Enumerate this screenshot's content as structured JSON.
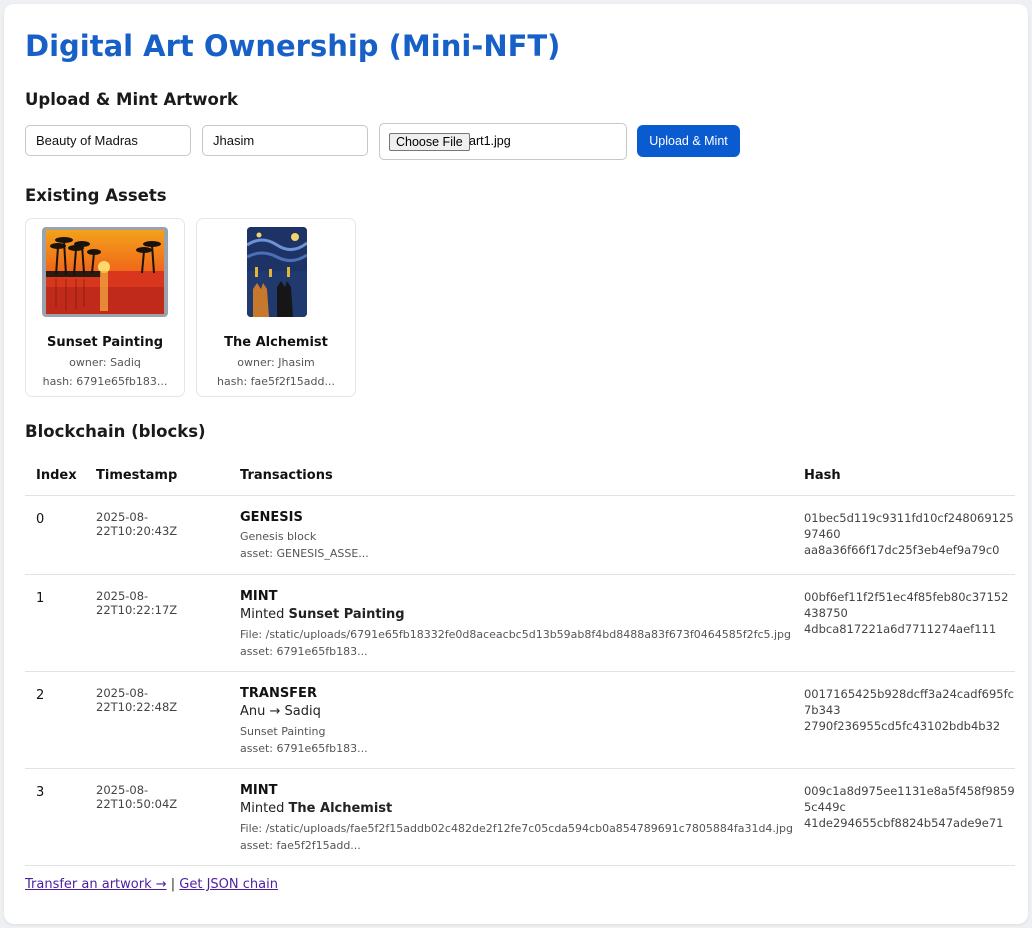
{
  "page": {
    "title": "Digital Art Ownership (Mini-NFT)"
  },
  "upload": {
    "heading": "Upload & Mint Artwork",
    "title_value": "Beauty of Madras",
    "owner_value": "Jhasim",
    "file_button": "Choose File",
    "file_name": "art1.jpg",
    "submit_label": "Upload & Mint"
  },
  "assets": {
    "heading": "Existing Assets",
    "items": [
      {
        "title": "Sunset Painting",
        "owner": "owner: Sadiq",
        "hash": "hash: 6791e65fb183..."
      },
      {
        "title": "The Alchemist",
        "owner": "owner: Jhasim",
        "hash": "hash: fae5f2f15add..."
      }
    ]
  },
  "chain": {
    "heading": "Blockchain (blocks)",
    "columns": [
      "Index",
      "Timestamp",
      "Transactions",
      "Hash"
    ],
    "blocks": [
      {
        "index": "0",
        "timestamp": "2025-08-22T10:20:43Z",
        "type": "GENESIS",
        "sub1": "Genesis block",
        "sub2": "asset: GENESIS_ASSE...",
        "hash1": "01bec5d119c9311fd10cf24806912597460",
        "hash2": "aa8a36f66f17dc25f3eb4ef9a79c0"
      },
      {
        "index": "1",
        "timestamp": "2025-08-22T10:22:17Z",
        "type": "MINT",
        "main_prefix": "Minted ",
        "main_bold": "Sunset Painting",
        "sub1": "File: /static/uploads/6791e65fb18332fe0d8aceacbc5d13b59ab8f4bd8488a83f673f0464585f2fc5.jpg",
        "sub2": "asset: 6791e65fb183...",
        "hash1": "00bf6ef11f2f51ec4f85feb80c37152438750",
        "hash2": "4dbca817221a6d7711274aef111"
      },
      {
        "index": "2",
        "timestamp": "2025-08-22T10:22:48Z",
        "type": "TRANSFER",
        "main_text": "Anu → Sadiq",
        "sub1": "Sunset Painting",
        "sub2": "asset: 6791e65fb183...",
        "hash1": "0017165425b928dcff3a24cadf695fc7b343",
        "hash2": "2790f236955cd5fc43102bdb4b32"
      },
      {
        "index": "3",
        "timestamp": "2025-08-22T10:50:04Z",
        "type": "MINT",
        "main_prefix": "Minted ",
        "main_bold": "The Alchemist",
        "sub1": "File: /static/uploads/fae5f2f15addb02c482de2f12fe7c05cda594cb0a854789691c7805884fa31d4.jpg",
        "sub2": "asset: fae5f2f15add...",
        "hash1": "009c1a8d975ee1131e8a5f458f98595c449c",
        "hash2": "41de294655cbf8824b547ade9e71"
      }
    ]
  },
  "footer": {
    "transfer_link": "Transfer an artwork →",
    "separator": " | ",
    "json_link": "Get JSON chain"
  }
}
